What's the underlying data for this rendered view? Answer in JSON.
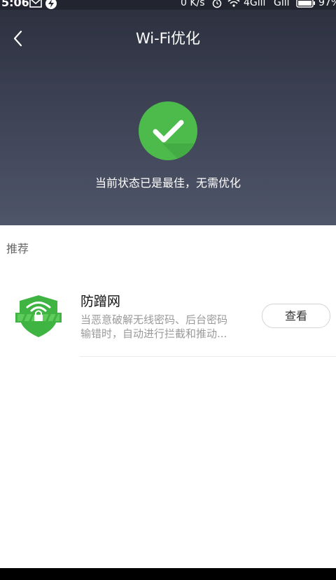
{
  "status_bar": {
    "time": "5:06",
    "net_speed": "0 K/s",
    "network_1": "4Gıll",
    "network_2": "Gıll",
    "battery": "97%"
  },
  "header": {
    "title": "Wi-Fi优化"
  },
  "status": {
    "message": "当前状态已是最佳，无需优化"
  },
  "section": {
    "label": "推荐"
  },
  "recommendation": {
    "title": "防蹭网",
    "description_line1": "当恶意破解无线密码、后台密码",
    "description_line2": "输错时，自动进行拦截和推动...",
    "button_label": "查看"
  },
  "colors": {
    "check_green": "#4cbb4c",
    "shield_green": "#3fb443",
    "hero_top": "#2b2f3d",
    "hero_bottom": "#4f5569"
  },
  "icons": {
    "back": "chevron-left-icon",
    "check": "checkmark-icon",
    "shield": "wifi-shield-lock-icon"
  }
}
